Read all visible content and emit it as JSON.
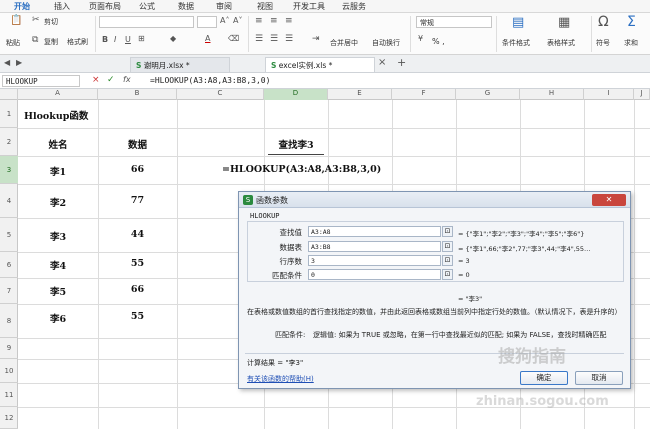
{
  "menu": {
    "tabs": [
      "开始",
      "插入",
      "页面布局",
      "公式",
      "数据",
      "审阅",
      "视图",
      "开发工具",
      "云服务"
    ]
  },
  "ribbon": {
    "cut": "剪切",
    "paste": "粘贴",
    "copy": "复制",
    "format_painter": "格式刷",
    "merge_center": "合并居中",
    "wrap_text": "自动换行",
    "number_format": "常规",
    "conditional_format": "条件格式",
    "table_style": "表格样式",
    "symbol": "符号",
    "sum": "求和",
    "number_tools": "% ,"
  },
  "doc_tabs": [
    "谢明月.xlsx *",
    "excel实例.xls *"
  ],
  "formula_bar": {
    "name_box": "HLOOKUP",
    "formula": "=HLOOKUP(A3:A8,A3:B8,3,0)"
  },
  "grid": {
    "columns": [
      "A",
      "B",
      "C",
      "D",
      "E",
      "F",
      "G",
      "H",
      "I",
      "J"
    ],
    "rows": [
      "1",
      "2",
      "3",
      "4",
      "5",
      "6",
      "7",
      "8",
      "9",
      "10",
      "11",
      "12"
    ],
    "a1": "Hlookup函数",
    "headers": {
      "name": "姓名",
      "data": "数据",
      "find": "查找李3"
    },
    "records": [
      {
        "name": "李1",
        "value": "66"
      },
      {
        "name": "李2",
        "value": "77"
      },
      {
        "name": "李3",
        "value": "44"
      },
      {
        "name": "李4",
        "value": "55"
      },
      {
        "name": "李5",
        "value": "66"
      },
      {
        "name": "李6",
        "value": "55"
      }
    ],
    "c3_formula": "=HLOOKUP(A3:A8,A3:B8,3,0)"
  },
  "dialog": {
    "title": "函数参数",
    "function_name": "HLOOKUP",
    "params": [
      {
        "label": "查找值",
        "value": "A3:A8",
        "result": "= {\"李1\";\"李2\";\"李3\";\"李4\";\"李5\";\"李6\"}"
      },
      {
        "label": "数据表",
        "value": "A3:B8",
        "result": "= {\"李1\",66;\"李2\",77;\"李3\",44;\"李4\",55…"
      },
      {
        "label": "行序数",
        "value": "3",
        "result": "= 3"
      },
      {
        "label": "匹配条件",
        "value": "0",
        "result": "= 0"
      }
    ],
    "result_preview": "= \"李3\"",
    "description": "在表格或数值数组的首行查找指定的数值，并由此返回表格或数组当前列中指定行处的数值。（默认情况下，表是升序的）",
    "arg_label": "匹配条件:",
    "arg_description": "逻辑值: 如果为 TRUE 或忽略，在第一行中查找最近似的匹配; 如果为 FALSE，查找时精确匹配",
    "calc_result": "计算结果 = \"李3\"",
    "help_link": "有关该函数的帮助(H)",
    "ok": "确定",
    "cancel": "取消"
  },
  "watermark": "搜狗指南",
  "watermark_url": "zhinan.sogou.com"
}
